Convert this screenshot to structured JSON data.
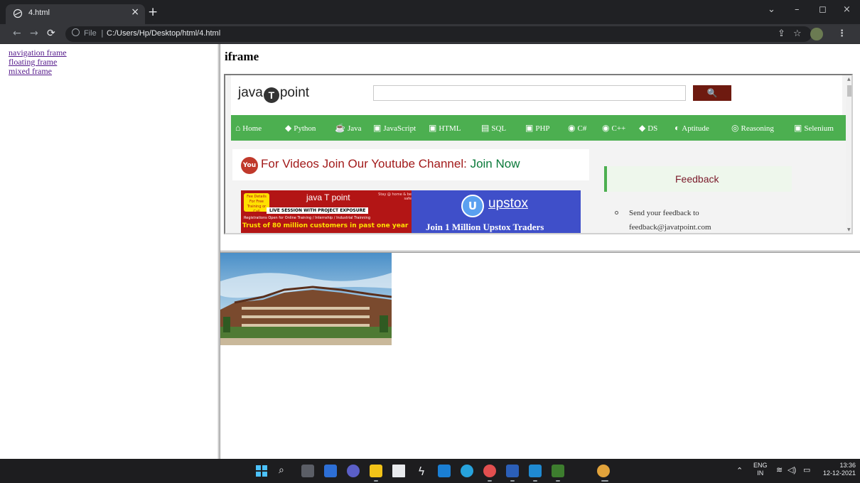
{
  "browser": {
    "tab_title": "4.html",
    "tab_close": "×",
    "new_tab": "+",
    "file_label": "File",
    "url": "C:/Users/Hp/Desktop/html/4.html",
    "controls": {
      "minimize": "–",
      "restore": "◻",
      "close": "×",
      "dropdown": "⌄"
    },
    "icons": [
      "share-icon",
      "star-icon",
      "profile-avatar",
      "menu-dots-icon"
    ]
  },
  "left_frame": {
    "links": [
      "navigation frame",
      "floating frame",
      "mixed frame"
    ]
  },
  "iframe_section": {
    "heading": "iframe",
    "site": {
      "logo_left": "java",
      "logo_mid": "T",
      "logo_right": "point",
      "search_button": "🔍",
      "nav": [
        {
          "icon": "⌂",
          "label": "Home"
        },
        {
          "icon": "◆",
          "label": "Python"
        },
        {
          "icon": "☕",
          "label": "Java"
        },
        {
          "icon": "▣",
          "label": "JavaScript"
        },
        {
          "icon": "▣",
          "label": "HTML"
        },
        {
          "icon": "▤",
          "label": "SQL"
        },
        {
          "icon": "▣",
          "label": "PHP"
        },
        {
          "icon": "◉",
          "label": "C#"
        },
        {
          "icon": "◉",
          "label": "C++"
        },
        {
          "icon": "◆",
          "label": "DS"
        },
        {
          "icon": "◐",
          "label": "Aptitude"
        },
        {
          "icon": "◎",
          "label": "Reasoning"
        },
        {
          "icon": "▣",
          "label": "Selenium"
        }
      ],
      "youtube": {
        "text": "For Videos Join Our Youtube Channel:",
        "link": "Join Now"
      },
      "ad1": {
        "badge": "Fee Details For Free Training or Call",
        "title": "java T point",
        "stay": "Stay @ home & be safe",
        "live": "LIVE SESSION WITH PROJECT EXPOSURE",
        "registration": "Registrations Open for Online Training / Internship / Industrial Trainning",
        "trust": "Trust of 80 million customers in past one year"
      },
      "ad2": {
        "name": "upstox",
        "headline": "Join 1 Million Upstox Traders"
      },
      "feedback": {
        "title": "Feedback",
        "items": [
          "Send your feedback to",
          "feedback@javatpoint.com"
        ]
      }
    }
  },
  "taskbar": {
    "tray": {
      "lang_top": "ENG",
      "lang_bottom": "IN",
      "time": "13:36",
      "date": "12-12-2021"
    }
  }
}
